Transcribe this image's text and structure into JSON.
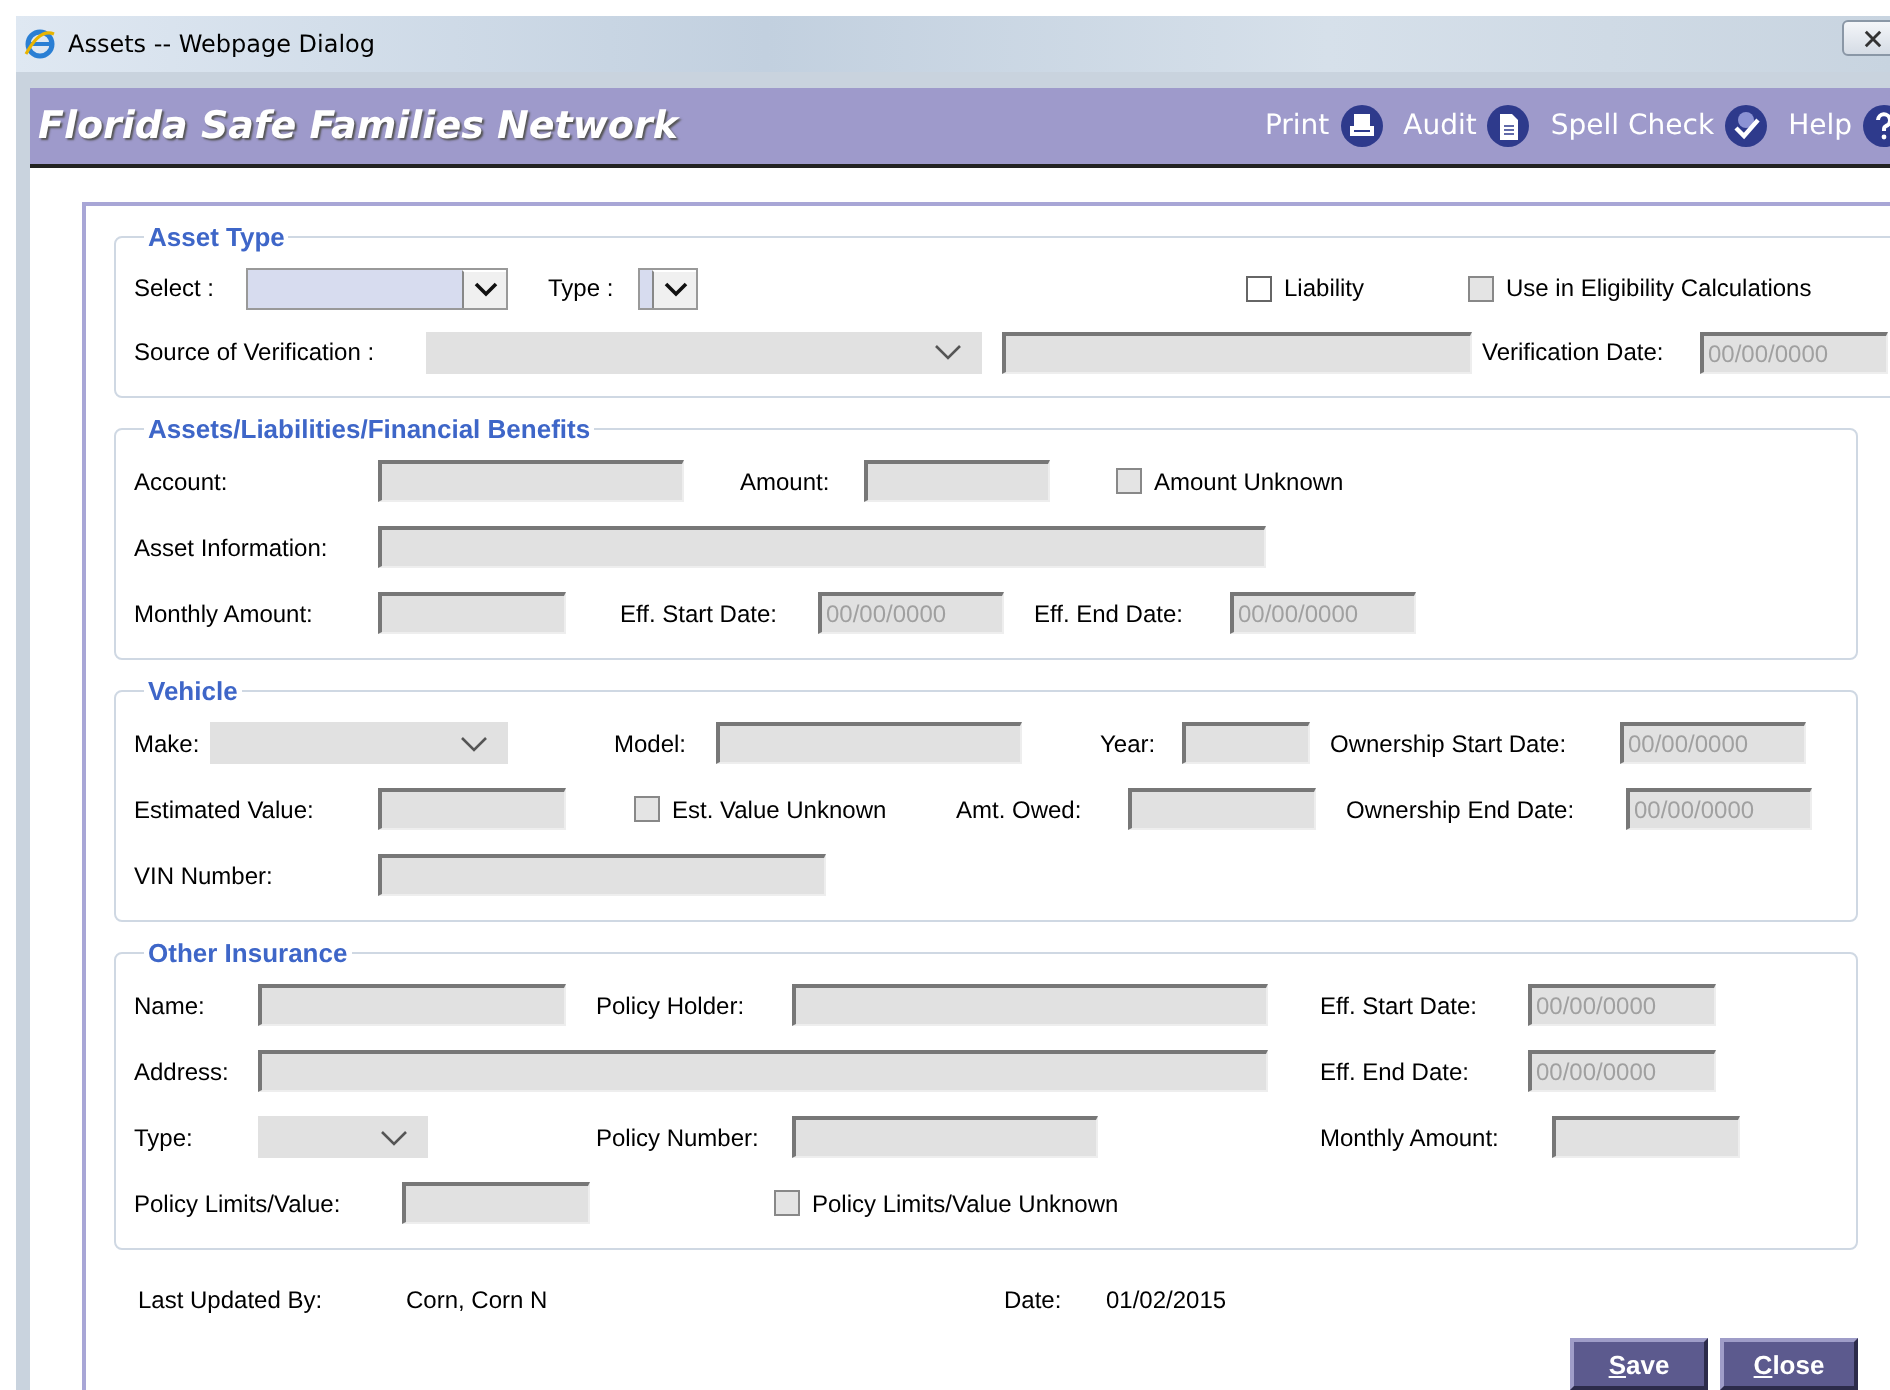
{
  "window": {
    "title": "Assets -- Webpage Dialog"
  },
  "header": {
    "title": "Florida Safe Families Network",
    "actions": [
      {
        "label": "Print"
      },
      {
        "label": "Audit"
      },
      {
        "label": "Spell Check"
      },
      {
        "label": "Help"
      }
    ]
  },
  "sections": [
    {
      "title": "Asset Type",
      "rows": [
        [
          {
            "kind": "select",
            "label": "Select :",
            "disabled": false
          },
          {
            "kind": "select",
            "label": "Type :",
            "disabled": false
          },
          {
            "kind": "checkbox",
            "label": "Liability",
            "checked": false,
            "disabled": false
          },
          {
            "kind": "checkbox",
            "label": "Use in Eligibility Calculations",
            "checked": false,
            "disabled": true
          }
        ],
        [
          {
            "kind": "select",
            "label": "Source of Verification :",
            "disabled": true
          },
          {
            "kind": "input"
          },
          "",
          {
            "kind": "date",
            "label": "Verification Date:",
            "value": "00/00/0000"
          }
        ]
      ]
    },
    {
      "title": "Assets/Liabilities/Financial Benefits",
      "rows": [
        [
          {
            "kind": "input",
            "label": "Account:"
          },
          {
            "kind": "input",
            "label": "Amount:"
          },
          {
            "kind": "checkbox",
            "label": "Amount Unknown",
            "checked": false,
            "disabled": true
          }
        ],
        [
          {
            "kind": "input",
            "label": "Asset Information:"
          }
        ],
        [
          {
            "kind": "input",
            "label": "Monthly Amount:"
          },
          {
            "kind": "date",
            "label": "Eff. Start Date:",
            "value": "00/00/0000"
          },
          {
            "kind": "date",
            "label": "Eff. End Date:",
            "value": "00/00/0000"
          }
        ]
      ]
    },
    {
      "title": "Vehicle",
      "rows": [
        [
          {
            "kind": "select",
            "label": "Make:",
            "disabled": true
          },
          {
            "kind": "input",
            "label": "Model:"
          },
          {
            "kind": "input",
            "label": "Year:"
          },
          {
            "kind": "date",
            "label": "Ownership Start Date:",
            "value": "00/00/0000"
          }
        ],
        [
          {
            "kind": "input",
            "label": "Estimated Value:"
          },
          {
            "kind": "checkbox",
            "label": "Est. Value Unknown",
            "checked": false,
            "disabled": true
          },
          {
            "kind": "input",
            "label": "Amt. Owed:"
          },
          {
            "kind": "date",
            "label": "Ownership End Date:",
            "value": "00/00/0000"
          }
        ],
        [
          {
            "kind": "input",
            "label": "VIN Number:"
          }
        ]
      ]
    },
    {
      "title": "Other Insurance",
      "rows": [
        [
          {
            "kind": "input",
            "label": "Name:"
          },
          {
            "kind": "input",
            "label": "Policy Holder:"
          },
          {
            "kind": "date",
            "label": "Eff. Start Date:",
            "value": "00/00/0000"
          }
        ],
        [
          {
            "kind": "input",
            "label": "Address:"
          },
          "",
          {
            "kind": "date",
            "label": "Eff. End Date:",
            "value": "00/00/0000"
          }
        ],
        [
          {
            "kind": "select",
            "label": "Type:",
            "disabled": true
          },
          {
            "kind": "input",
            "label": "Policy Number:"
          },
          {
            "kind": "input",
            "label": "Monthly Amount:"
          }
        ],
        [
          {
            "kind": "input",
            "label": "Policy Limits/Value:"
          },
          {
            "kind": "checkbox",
            "label": "Policy Limits/Value Unknown",
            "checked": false,
            "disabled": true
          }
        ]
      ]
    }
  ],
  "footer": {
    "last_updated_label": "Last Updated By:",
    "last_updated_value": "Corn, Corn N",
    "date_label": "Date:",
    "date_value": "01/02/2015"
  },
  "buttons": [
    {
      "label": "Save"
    },
    {
      "label": "Close"
    }
  ]
}
